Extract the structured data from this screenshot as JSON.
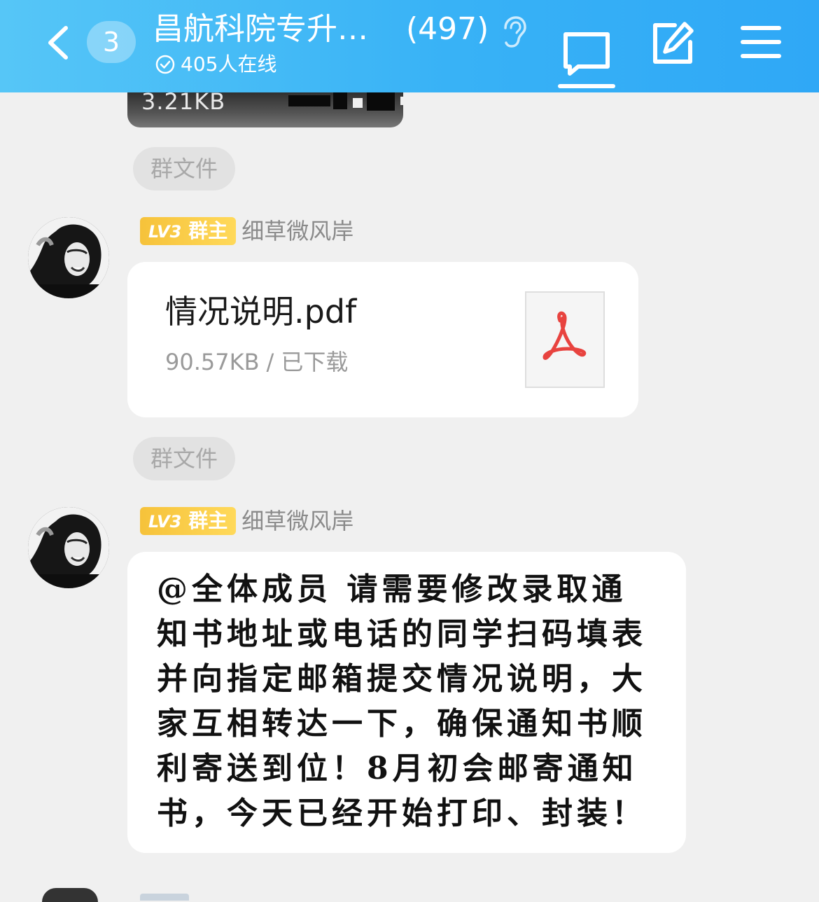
{
  "header": {
    "back_label": "",
    "unread_count": "3",
    "title": "昌航科院专升…",
    "member_count": "(497)",
    "online_status": "405人在线",
    "colors": {
      "header_gradient_start": "#56c6f7",
      "header_gradient_end": "#2fa8f6"
    },
    "icons": [
      "chevron-left-icon",
      "ear-icon",
      "check-circle-icon",
      "chat-bubble-icon",
      "edit-icon",
      "menu-icon"
    ]
  },
  "messages": {
    "previous": {
      "size_text": "3.21KB"
    },
    "tag1": "群文件",
    "file_message": {
      "level": "LV3",
      "role": "群主",
      "sender": "细草微风岸",
      "file_name": "情况说明.pdf",
      "file_size": "90.57KB",
      "separator": "/",
      "status": "已下载",
      "icon": "pdf-icon"
    },
    "tag2": "群文件",
    "text_message": {
      "level": "LV3",
      "role": "群主",
      "sender": "细草微风岸",
      "text": "@全体成员 请需要修改录取通知书地址或电话的同学扫码填表并向指定邮箱提交情况说明，大家互相转达一下，确保通知书顺利寄送到位！8月初会邮寄通知书，今天已经开始打印、封装！"
    }
  },
  "colors": {
    "background": "#f0f0f0",
    "badge_gold": "#f6c23a",
    "pdf_red": "#e8433f",
    "tag_bg": "#e2e2e2"
  }
}
